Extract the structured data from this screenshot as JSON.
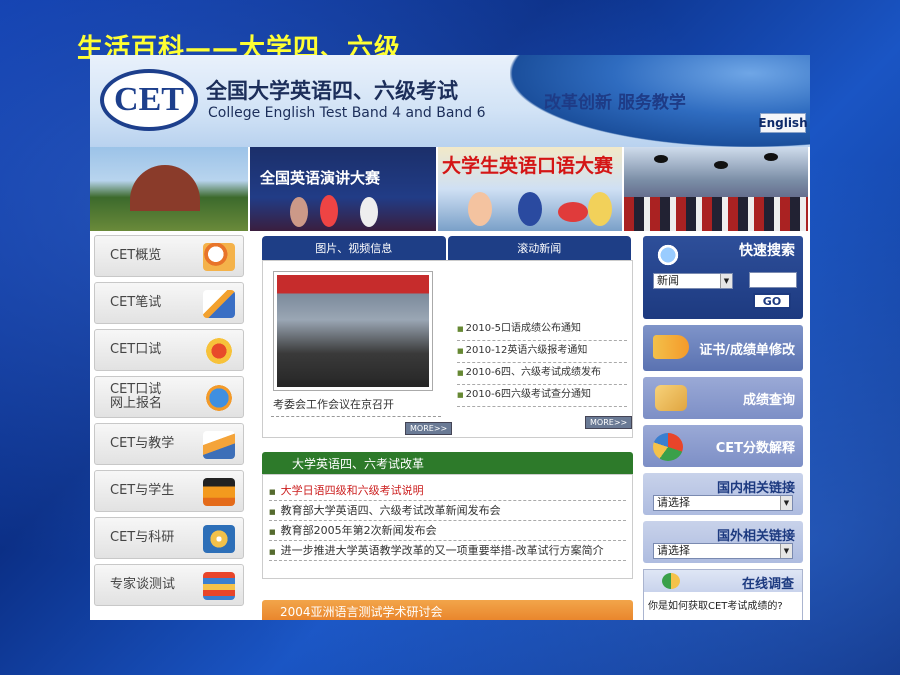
{
  "slide_title": "生活百科——大学四、六级",
  "header": {
    "logo_text": "CET",
    "title_cn": "全国大学英语四、六级考试",
    "title_en": "College English Test Band 4 and Band 6",
    "slogan": "改革创新  服务教学",
    "lang_button": "English"
  },
  "banner": {
    "photo2_caption": "全国英语演讲大赛",
    "photo3_caption": "大学生英语口语大赛"
  },
  "left_nav": [
    {
      "label": "CET概览",
      "icon": "magnifier-icon"
    },
    {
      "label": "CET笔试",
      "icon": "pen-icon"
    },
    {
      "label": "CET口试",
      "icon": "headset-icon"
    },
    {
      "label": "CET口试\n网上报名",
      "icon": "globe-icon"
    },
    {
      "label": "CET与教学",
      "icon": "book-icon"
    },
    {
      "label": "CET与学生",
      "icon": "graduation-icon"
    },
    {
      "label": "CET与科研",
      "icon": "cd-icon"
    },
    {
      "label": "专家谈测试",
      "icon": "books-stack-icon"
    }
  ],
  "center": {
    "tabs": [
      "图片、视频信息",
      "滚动新闻"
    ],
    "photo_caption": "考委会工作会议在京召开",
    "more_label": "MORE>>",
    "news": [
      "2010-5口语成绩公布通知",
      "2010-12英语六级报考通知",
      "2010-6四、六级考试成绩发布",
      "2010-6四六级考试查分通知"
    ],
    "reform_title": "大学英语四、六考试改革",
    "reform_items": [
      "大学日语四级和六级考试说明",
      "教育部大学英语四、六级考试改革新闻发布会",
      "教育部2005年第2次新闻发布会",
      "进一步推进大学英语教学改革的又一项重要举措-改革试行方案简介"
    ],
    "conference_title": "2004亚洲语言测试学术研讨会"
  },
  "right": {
    "search_title": "快速搜索",
    "search_category": "新闻",
    "go_label": "GO",
    "cert_label": "证书/成绩单修改",
    "score_label": "成绩查询",
    "explain_label": "CET分数解释",
    "domestic_links_title": "国内相关链接",
    "foreign_links_title": "国外相关链接",
    "select_placeholder": "请选择",
    "survey_title": "在线调查",
    "survey_question": "你是如何获取CET考试成绩的?"
  },
  "colors": {
    "title_yellow": "#ffff33",
    "nav_blue": "#1e3e86",
    "reform_green": "#2d7a2a",
    "hot_red": "#cc1f1f"
  }
}
